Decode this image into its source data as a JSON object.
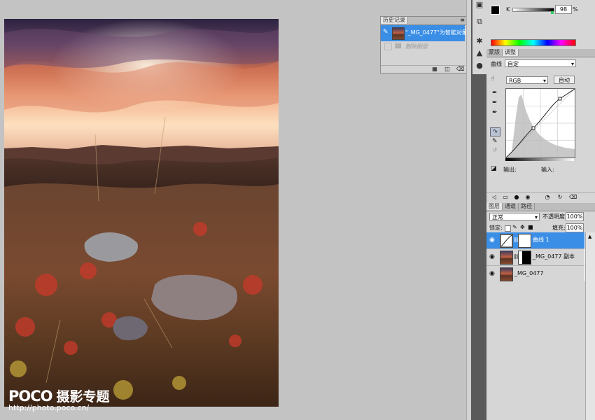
{
  "watermark": {
    "logo": "POCO",
    "title": "摄影专题",
    "url": "http://photo.poco.cn/"
  },
  "history": {
    "tabs": [
      "历史记录"
    ],
    "items": [
      {
        "label": "\"_MG_0477\"为智能对象...",
        "selected": true
      },
      {
        "label": "删除图层",
        "selected": false
      }
    ]
  },
  "color_panel": {
    "channel": "K",
    "value": "98",
    "unit": "%"
  },
  "adjust_panel": {
    "tabs": [
      "蒙版",
      "调整"
    ],
    "curves_label": "曲线",
    "preset": "自定",
    "channel": "RGB",
    "auto_label": "自动",
    "output_label": "输出:",
    "input_label": "输入:"
  },
  "layers_panel": {
    "tabs": [
      "图层",
      "通道",
      "路径"
    ],
    "blend_mode": "正常",
    "opacity_label": "不透明度:",
    "opacity": "100%",
    "lock_label": "锁定:",
    "fill_label": "填充:",
    "fill": "100%",
    "layers": [
      {
        "name": "曲线 1",
        "selected": true
      },
      {
        "name": "_MG_0477 副本",
        "selected": false
      },
      {
        "name": "_MG_0477",
        "selected": false
      }
    ]
  },
  "icons": [
    "history-icon",
    "layers-comp-icon",
    "brush-icon",
    "swatch-icon",
    "info-icon",
    "navigator-icon",
    "eye-icon",
    "link-icon",
    "trash-icon",
    "new-layer-icon",
    "eyedropper-icon",
    "curve-tool-icon",
    "pencil-icon"
  ],
  "colors": {
    "selection": "#3a8ee6",
    "panel": "#d6d6d6",
    "workspace": "#c3c3c3"
  }
}
